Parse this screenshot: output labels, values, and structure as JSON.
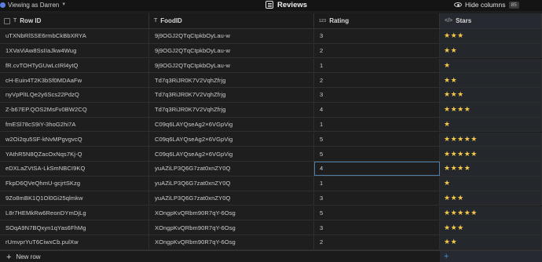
{
  "topbar": {
    "viewing_label": "Viewing as Darren",
    "title": "Reviews",
    "hide_columns_label": "Hide columns",
    "hide_columns_count": "85"
  },
  "columns": [
    {
      "label": "Row ID",
      "type_icon": "T"
    },
    {
      "label": "FoodID",
      "type_icon": "T"
    },
    {
      "label": "Rating",
      "type_icon": "123"
    },
    {
      "label": "Stars",
      "type_icon": "</>"
    }
  ],
  "rows": [
    {
      "row_id": "uTXNbRlSSE6rmbCkBbXRYA",
      "food_id": "9j9OGJ2QTqCtpkbOyLau-w",
      "rating": "3",
      "stars": "★★★"
    },
    {
      "row_id": "1XVaViAw8SsIIaJkw4Wug",
      "food_id": "9j9OGJ2QTqCtpkbOyLau-w",
      "rating": "2",
      "stars": "★★"
    },
    {
      "row_id": "fR.cvTOHTyGUwLcIRl4ytQ",
      "food_id": "9j9OGJ2QTqCtpkbOyLau-w",
      "rating": "1",
      "stars": "★"
    },
    {
      "row_id": "cH-Euin4T2K3bSf0MDAaFw",
      "food_id": "Td7q3RiJR0K7V2VqhZfrjg",
      "rating": "2",
      "stars": "★★"
    },
    {
      "row_id": "nyVpPlILQe2y6Scs22PdzQ",
      "food_id": "Td7q3RiJR0K7V2VqhZfrjg",
      "rating": "3",
      "stars": "★★★"
    },
    {
      "row_id": "Z-b67EP.QOS2MsFv0BW2CQ",
      "food_id": "Td7q3RiJR0K7V2VqhZfrjg",
      "rating": "4",
      "stars": "★★★★"
    },
    {
      "row_id": "fmESl78cS9iY-3hoG2hi7A",
      "food_id": "C09q6LAYQseAg2×6VGpVig",
      "rating": "1",
      "stars": "★"
    },
    {
      "row_id": "w2Oi2qu5SF-kNvMPgvgvcQ",
      "food_id": "C09q6LAYQseAg2×6VGpVig",
      "rating": "5",
      "stars": "★★★★★"
    },
    {
      "row_id": "YAthR5N8QZacOxNqs7Kj-Q",
      "food_id": "C09q6LAYQseAg2×6VGpVig",
      "rating": "5",
      "stars": "★★★★★"
    },
    {
      "row_id": "eDXLaZVtSA-LkSmNBCI9KQ",
      "food_id": "yuAZiLP3Q6G7zat0xnZY0Q",
      "rating": "4",
      "stars": "★★★★"
    },
    {
      "row_id": "FkpD6QVeQhmU-gcjrtSKzg",
      "food_id": "yuAZiLP3Q6G7zat0xnZY0Q",
      "rating": "1",
      "stars": "★"
    },
    {
      "row_id": "9Zo8mBK1Q1Ol0Gi25qlmkw",
      "food_id": "yuAZiLP3Q6G7zat0xnZY0Q",
      "rating": "3",
      "stars": "★★★"
    },
    {
      "row_id": "L8r7HEMkRw6ReonDYmDjLg",
      "food_id": "XOngpKvQRbm90R7qY-6Osg",
      "rating": "5",
      "stars": "★★★★★"
    },
    {
      "row_id": "SOqA9N7BQxyn1qYas6FhMg",
      "food_id": "XOngpKvQRbm90R7qY-6Osg",
      "rating": "3",
      "stars": "★★★"
    },
    {
      "row_id": "rUmvprYuT6CiwxCb.pulXw",
      "food_id": "XOngpKvQRbm90R7qY-6Osg",
      "rating": "2",
      "stars": "★★"
    }
  ],
  "footer": {
    "new_row_label": "New row"
  },
  "colors": {
    "star": "#f5c84a",
    "accent": "#4a8fd0",
    "background": "#1e1e1e"
  }
}
